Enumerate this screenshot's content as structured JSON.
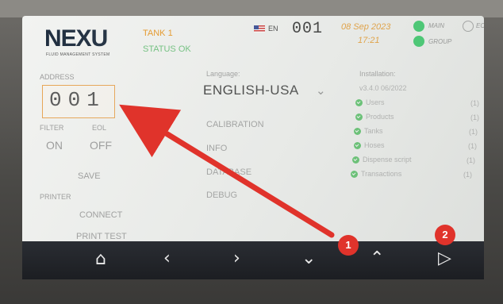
{
  "header": {
    "logo": "NEXU",
    "logo_sub": "FLUID MANAGEMENT SYSTEM",
    "tank": "TANK 1",
    "status": "STATUS OK",
    "language_code": "EN",
    "address_display": "001",
    "date": "08 Sep 2023",
    "time": "17:21",
    "main_label": "MAIN",
    "group_label": "GROUP",
    "eol_label": "EOL",
    "colors": {
      "accent": "#e8951f",
      "ok": "#22c75a",
      "status": "#6bc07a"
    }
  },
  "left": {
    "address_label": "ADDRESS",
    "address_value": "001",
    "filter_label": "FILTER",
    "eol_label": "EOL",
    "on_label": "ON",
    "off_label": "OFF",
    "save_label": "SAVE",
    "printer_label": "PRINTER",
    "connect_label": "CONNECT",
    "print_test_label": "PRINT TEST"
  },
  "middle": {
    "language_label": "Language:",
    "language_value": "ENGLISH-USA",
    "calibration": "CALIBRATION",
    "info": "INFO",
    "database": "DATABASE",
    "debug": "DEBUG"
  },
  "installation": {
    "title": "Installation:",
    "version": "v3.4.0 06/2022",
    "items": [
      {
        "label": "Users",
        "count": "(1)"
      },
      {
        "label": "Products",
        "count": "(1)"
      },
      {
        "label": "Tanks",
        "count": "(1)"
      },
      {
        "label": "Hoses",
        "count": "(1)"
      },
      {
        "label": "Dispense script",
        "count": "(1)"
      },
      {
        "label": "Transactions",
        "count": "(1)"
      }
    ]
  },
  "navbar": {
    "home_icon": "⌂",
    "prev_icon": "‹",
    "next_icon": "›",
    "down_icon": "⌄",
    "up_icon": "⌃",
    "last_icon": "▷"
  },
  "annotations": {
    "badge1": "1",
    "badge2": "2",
    "arrow_color": "#e0332b"
  }
}
